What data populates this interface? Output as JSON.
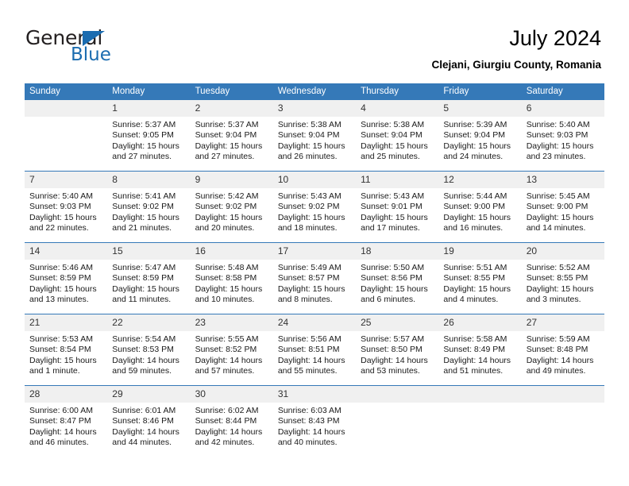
{
  "brand": {
    "name_part1": "General",
    "name_part2": "Blue",
    "accent_color": "#1b6cb0"
  },
  "header": {
    "title": "July 2024",
    "subtitle": "Clejani, Giurgiu County, Romania"
  },
  "calendar": {
    "header_bg": "#3579b8",
    "daynum_bg": "#f0f0f0",
    "weekdays": [
      "Sunday",
      "Monday",
      "Tuesday",
      "Wednesday",
      "Thursday",
      "Friday",
      "Saturday"
    ],
    "weeks": [
      [
        {
          "day": "",
          "empty": true,
          "sunrise": "",
          "sunset": "",
          "daylight_1": "",
          "daylight_2": ""
        },
        {
          "day": "1",
          "sunrise": "Sunrise: 5:37 AM",
          "sunset": "Sunset: 9:05 PM",
          "daylight_1": "Daylight: 15 hours",
          "daylight_2": "and 27 minutes."
        },
        {
          "day": "2",
          "sunrise": "Sunrise: 5:37 AM",
          "sunset": "Sunset: 9:04 PM",
          "daylight_1": "Daylight: 15 hours",
          "daylight_2": "and 27 minutes."
        },
        {
          "day": "3",
          "sunrise": "Sunrise: 5:38 AM",
          "sunset": "Sunset: 9:04 PM",
          "daylight_1": "Daylight: 15 hours",
          "daylight_2": "and 26 minutes."
        },
        {
          "day": "4",
          "sunrise": "Sunrise: 5:38 AM",
          "sunset": "Sunset: 9:04 PM",
          "daylight_1": "Daylight: 15 hours",
          "daylight_2": "and 25 minutes."
        },
        {
          "day": "5",
          "sunrise": "Sunrise: 5:39 AM",
          "sunset": "Sunset: 9:04 PM",
          "daylight_1": "Daylight: 15 hours",
          "daylight_2": "and 24 minutes."
        },
        {
          "day": "6",
          "sunrise": "Sunrise: 5:40 AM",
          "sunset": "Sunset: 9:03 PM",
          "daylight_1": "Daylight: 15 hours",
          "daylight_2": "and 23 minutes."
        }
      ],
      [
        {
          "day": "7",
          "sunrise": "Sunrise: 5:40 AM",
          "sunset": "Sunset: 9:03 PM",
          "daylight_1": "Daylight: 15 hours",
          "daylight_2": "and 22 minutes."
        },
        {
          "day": "8",
          "sunrise": "Sunrise: 5:41 AM",
          "sunset": "Sunset: 9:02 PM",
          "daylight_1": "Daylight: 15 hours",
          "daylight_2": "and 21 minutes."
        },
        {
          "day": "9",
          "sunrise": "Sunrise: 5:42 AM",
          "sunset": "Sunset: 9:02 PM",
          "daylight_1": "Daylight: 15 hours",
          "daylight_2": "and 20 minutes."
        },
        {
          "day": "10",
          "sunrise": "Sunrise: 5:43 AM",
          "sunset": "Sunset: 9:02 PM",
          "daylight_1": "Daylight: 15 hours",
          "daylight_2": "and 18 minutes."
        },
        {
          "day": "11",
          "sunrise": "Sunrise: 5:43 AM",
          "sunset": "Sunset: 9:01 PM",
          "daylight_1": "Daylight: 15 hours",
          "daylight_2": "and 17 minutes."
        },
        {
          "day": "12",
          "sunrise": "Sunrise: 5:44 AM",
          "sunset": "Sunset: 9:00 PM",
          "daylight_1": "Daylight: 15 hours",
          "daylight_2": "and 16 minutes."
        },
        {
          "day": "13",
          "sunrise": "Sunrise: 5:45 AM",
          "sunset": "Sunset: 9:00 PM",
          "daylight_1": "Daylight: 15 hours",
          "daylight_2": "and 14 minutes."
        }
      ],
      [
        {
          "day": "14",
          "sunrise": "Sunrise: 5:46 AM",
          "sunset": "Sunset: 8:59 PM",
          "daylight_1": "Daylight: 15 hours",
          "daylight_2": "and 13 minutes."
        },
        {
          "day": "15",
          "sunrise": "Sunrise: 5:47 AM",
          "sunset": "Sunset: 8:59 PM",
          "daylight_1": "Daylight: 15 hours",
          "daylight_2": "and 11 minutes."
        },
        {
          "day": "16",
          "sunrise": "Sunrise: 5:48 AM",
          "sunset": "Sunset: 8:58 PM",
          "daylight_1": "Daylight: 15 hours",
          "daylight_2": "and 10 minutes."
        },
        {
          "day": "17",
          "sunrise": "Sunrise: 5:49 AM",
          "sunset": "Sunset: 8:57 PM",
          "daylight_1": "Daylight: 15 hours",
          "daylight_2": "and 8 minutes."
        },
        {
          "day": "18",
          "sunrise": "Sunrise: 5:50 AM",
          "sunset": "Sunset: 8:56 PM",
          "daylight_1": "Daylight: 15 hours",
          "daylight_2": "and 6 minutes."
        },
        {
          "day": "19",
          "sunrise": "Sunrise: 5:51 AM",
          "sunset": "Sunset: 8:55 PM",
          "daylight_1": "Daylight: 15 hours",
          "daylight_2": "and 4 minutes."
        },
        {
          "day": "20",
          "sunrise": "Sunrise: 5:52 AM",
          "sunset": "Sunset: 8:55 PM",
          "daylight_1": "Daylight: 15 hours",
          "daylight_2": "and 3 minutes."
        }
      ],
      [
        {
          "day": "21",
          "sunrise": "Sunrise: 5:53 AM",
          "sunset": "Sunset: 8:54 PM",
          "daylight_1": "Daylight: 15 hours",
          "daylight_2": "and 1 minute."
        },
        {
          "day": "22",
          "sunrise": "Sunrise: 5:54 AM",
          "sunset": "Sunset: 8:53 PM",
          "daylight_1": "Daylight: 14 hours",
          "daylight_2": "and 59 minutes."
        },
        {
          "day": "23",
          "sunrise": "Sunrise: 5:55 AM",
          "sunset": "Sunset: 8:52 PM",
          "daylight_1": "Daylight: 14 hours",
          "daylight_2": "and 57 minutes."
        },
        {
          "day": "24",
          "sunrise": "Sunrise: 5:56 AM",
          "sunset": "Sunset: 8:51 PM",
          "daylight_1": "Daylight: 14 hours",
          "daylight_2": "and 55 minutes."
        },
        {
          "day": "25",
          "sunrise": "Sunrise: 5:57 AM",
          "sunset": "Sunset: 8:50 PM",
          "daylight_1": "Daylight: 14 hours",
          "daylight_2": "and 53 minutes."
        },
        {
          "day": "26",
          "sunrise": "Sunrise: 5:58 AM",
          "sunset": "Sunset: 8:49 PM",
          "daylight_1": "Daylight: 14 hours",
          "daylight_2": "and 51 minutes."
        },
        {
          "day": "27",
          "sunrise": "Sunrise: 5:59 AM",
          "sunset": "Sunset: 8:48 PM",
          "daylight_1": "Daylight: 14 hours",
          "daylight_2": "and 49 minutes."
        }
      ],
      [
        {
          "day": "28",
          "sunrise": "Sunrise: 6:00 AM",
          "sunset": "Sunset: 8:47 PM",
          "daylight_1": "Daylight: 14 hours",
          "daylight_2": "and 46 minutes."
        },
        {
          "day": "29",
          "sunrise": "Sunrise: 6:01 AM",
          "sunset": "Sunset: 8:46 PM",
          "daylight_1": "Daylight: 14 hours",
          "daylight_2": "and 44 minutes."
        },
        {
          "day": "30",
          "sunrise": "Sunrise: 6:02 AM",
          "sunset": "Sunset: 8:44 PM",
          "daylight_1": "Daylight: 14 hours",
          "daylight_2": "and 42 minutes."
        },
        {
          "day": "31",
          "sunrise": "Sunrise: 6:03 AM",
          "sunset": "Sunset: 8:43 PM",
          "daylight_1": "Daylight: 14 hours",
          "daylight_2": "and 40 minutes."
        },
        {
          "day": "",
          "empty": true,
          "sunrise": "",
          "sunset": "",
          "daylight_1": "",
          "daylight_2": ""
        },
        {
          "day": "",
          "empty": true,
          "sunrise": "",
          "sunset": "",
          "daylight_1": "",
          "daylight_2": ""
        },
        {
          "day": "",
          "empty": true,
          "sunrise": "",
          "sunset": "",
          "daylight_1": "",
          "daylight_2": ""
        }
      ]
    ]
  }
}
